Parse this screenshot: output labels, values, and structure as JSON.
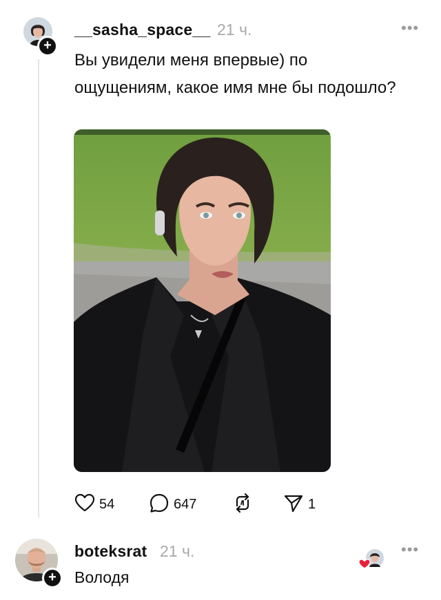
{
  "post": {
    "username": "__sasha_space__",
    "time": "21 ч.",
    "more": "•••",
    "text": "Вы увидели меня впервые) по ощущениям, какое имя мне бы подошло?",
    "image_alt": "selfie",
    "actions": {
      "likes": "54",
      "comments": "647",
      "shares": "1"
    }
  },
  "reply": {
    "username": "boteksrat",
    "time": "21 ч.",
    "more": "•••",
    "text": "Володя"
  },
  "icons": {
    "like": "heart-outline-icon",
    "comment": "speech-bubble-icon",
    "repost": "repost-arrows-icon",
    "share": "paper-plane-icon",
    "follow": "plus-icon"
  },
  "colors": {
    "text": "#111111",
    "muted": "#a8a8a8",
    "like_red": "#e8233b"
  }
}
